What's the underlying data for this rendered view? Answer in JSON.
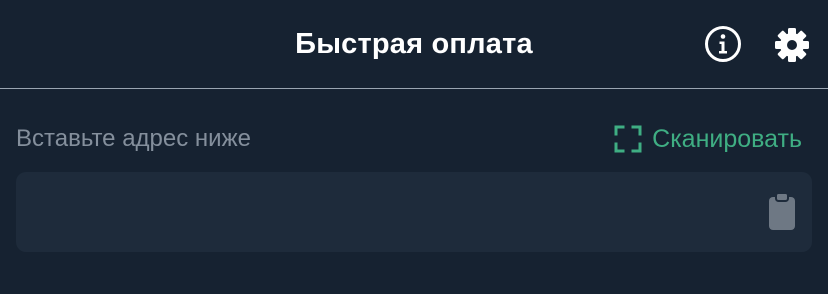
{
  "header": {
    "title": "Быстрая оплата",
    "info_icon": "info-circle-icon",
    "settings_icon": "gear-icon"
  },
  "address": {
    "label": "Вставьте адрес ниже",
    "scan_label": "Сканировать",
    "scan_icon": "scan-frame-icon",
    "input_value": "",
    "input_placeholder": "",
    "paste_icon": "clipboard-icon"
  },
  "colors": {
    "background": "#162231",
    "field_background": "#1e2b3b",
    "accent": "#3fae83",
    "label_text": "#848f9c",
    "icon_muted": "#6e7884"
  }
}
